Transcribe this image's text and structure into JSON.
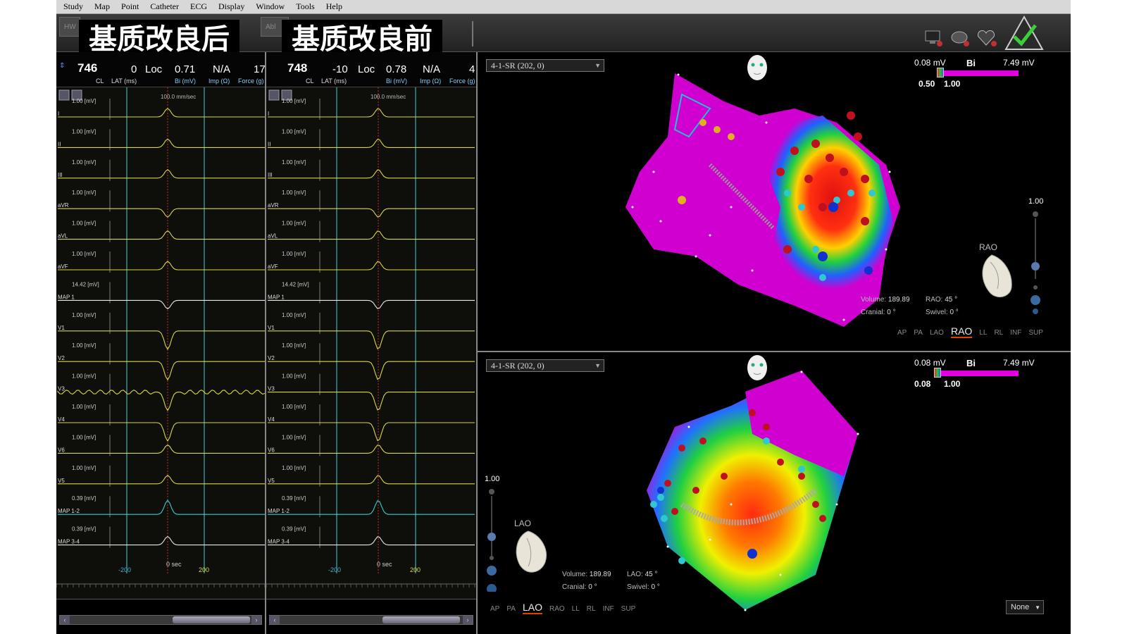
{
  "menu": [
    "Study",
    "Map",
    "Point",
    "Catheter",
    "ECG",
    "Display",
    "Window",
    "Tools",
    "Help"
  ],
  "toolbar": {
    "btn_left": "HW",
    "btn_mid": "Abl",
    "caption_left": "基质改良后",
    "caption_right": "基质改良前"
  },
  "ecg_left": {
    "cl": "746",
    "cl_label": "CL",
    "lat": "0",
    "lat_label": "LAT (ms)",
    "loc": "Loc",
    "bi": "0.71",
    "bi_label": "Bi (mV)",
    "imp": "N/A",
    "imp_label": "Imp (Ω)",
    "force": "17",
    "force_label": "Force (g)",
    "speed": "100.0 mm/sec",
    "time_ticks": [
      "-200",
      "0 sec",
      "200"
    ]
  },
  "ecg_right": {
    "cl": "748",
    "cl_label": "CL",
    "lat": "-10",
    "lat_label": "LAT (ms)",
    "loc": "Loc",
    "bi": "0.78",
    "bi_label": "Bi (mV)",
    "imp": "N/A",
    "imp_label": "Imp (Ω)",
    "force": "4",
    "force_label": "Force (g)",
    "speed": "100.0 mm/sec",
    "time_ticks": [
      "-200",
      "0 sec",
      "200"
    ]
  },
  "channels": [
    {
      "name": "I",
      "scale": "1.00  [mV]",
      "kind": "yellow"
    },
    {
      "name": "II",
      "scale": "1.00  [mV]",
      "kind": "yellow"
    },
    {
      "name": "III",
      "scale": "1.00  [mV]",
      "kind": "yellow"
    },
    {
      "name": "aVR",
      "scale": "1.00  [mV]",
      "kind": "yellow"
    },
    {
      "name": "aVL",
      "scale": "1.00  [mV]",
      "kind": "yellow"
    },
    {
      "name": "aVF",
      "scale": "1.00  [mV]",
      "kind": "yellow"
    },
    {
      "name": "MAP 1",
      "scale": "14.42  [mV]",
      "kind": "white"
    },
    {
      "name": "V1",
      "scale": "1.00  [mV]",
      "kind": "yellow"
    },
    {
      "name": "V2",
      "scale": "1.00  [mV]",
      "kind": "yellow"
    },
    {
      "name": "V3",
      "scale": "1.00  [mV]",
      "kind": "yellow"
    },
    {
      "name": "V4",
      "scale": "1.00  [mV]",
      "kind": "yellow"
    },
    {
      "name": "V6",
      "scale": "1.00  [mV]",
      "kind": "yellow"
    },
    {
      "name": "V5",
      "scale": "1.00  [mV]",
      "kind": "yellow"
    },
    {
      "name": "MAP 1-2",
      "scale": "0.39  [mV]",
      "kind": "cyan"
    },
    {
      "name": "MAP 3-4",
      "scale": "0.39  [mV]",
      "kind": "white"
    }
  ],
  "map_top": {
    "dropdown": "4-1-SR (202, 0)",
    "scale_min": "0.08 mV",
    "scale_type": "Bi",
    "scale_max": "7.49 mV",
    "range_low": "0.50",
    "range_high": "1.00",
    "slider_val": "1.00",
    "orientation": "RAO",
    "volume_label": "Volume:",
    "volume": "189.89",
    "angle1_label": "RAO:",
    "angle1": "45 °",
    "cranial_label": "Cranial:",
    "cranial": "0 °",
    "swivel_label": "Swivel:",
    "swivel": "0 °",
    "views": [
      "AP",
      "PA",
      "LAO",
      "RAO",
      "LL",
      "RL",
      "INF",
      "SUP"
    ],
    "active_view": "RAO"
  },
  "map_bottom": {
    "dropdown": "4-1-SR (202, 0)",
    "scale_min": "0.08 mV",
    "scale_type": "Bi",
    "scale_max": "7.49 mV",
    "range_low": "0.08",
    "range_high": "1.00",
    "slider_val": "1.00",
    "orientation": "LAO",
    "volume_label": "Volume:",
    "volume": "189.89",
    "angle1_label": "LAO:",
    "angle1": "45 °",
    "cranial_label": "Cranial:",
    "cranial": "0 °",
    "swivel_label": "Swivel:",
    "swivel": "0 °",
    "views": [
      "AP",
      "PA",
      "LAO",
      "RAO",
      "LL",
      "RL",
      "INF",
      "SUP"
    ],
    "active_view": "LAO",
    "none_select": "None"
  },
  "colors": {
    "magenta": "#d000d0",
    "ecg_yellow": "#d8d840",
    "ecg_cyan": "#30d0d0",
    "ref_line": "#40b0b0"
  }
}
